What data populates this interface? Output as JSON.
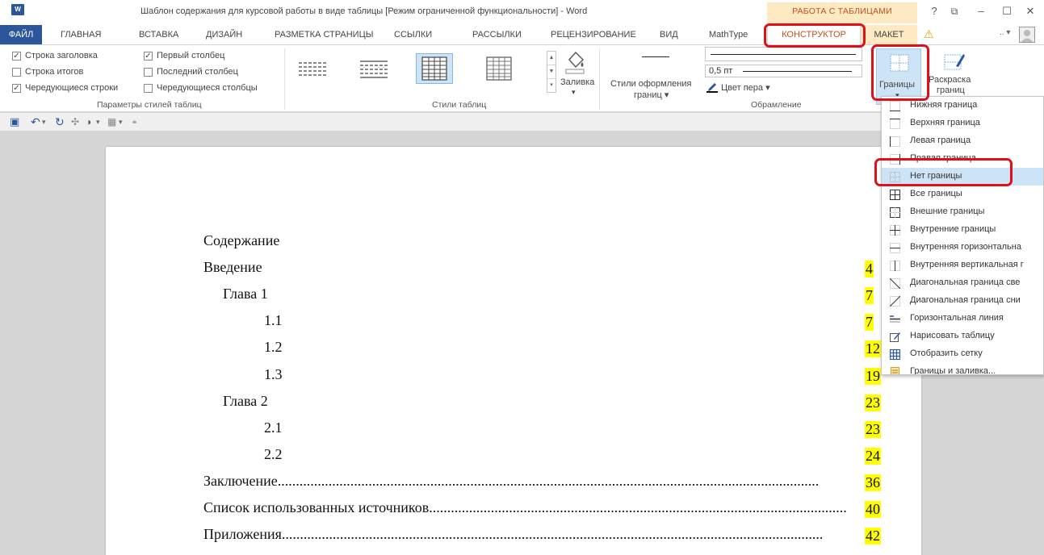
{
  "app": {
    "icon_label": "W",
    "title": "Шаблон содержания для курсовой работы в виде таблицы [Режим ограниченной функциональности] - Word",
    "context_group": "РАБОТА С ТАБЛИЦАМИ",
    "window_controls": [
      "?",
      "⧉",
      "–",
      "☐",
      "✕"
    ]
  },
  "tabs": {
    "file": "ФАЙЛ",
    "items": [
      "ГЛАВНАЯ",
      "ВСТАВКА",
      "ДИЗАЙН",
      "РАЗМЕТКА СТРАНИЦЫ",
      "ССЫЛКИ",
      "РАССЫЛКИ",
      "РЕЦЕНЗИРОВАНИЕ",
      "ВИД",
      "MathType"
    ],
    "context_active": "КОНСТРУКТОР",
    "context_other": "МАКЕТ"
  },
  "ribbon": {
    "style_options": {
      "group_label": "Параметры стилей таблиц",
      "options": [
        {
          "label": "Строка заголовка",
          "checked": true
        },
        {
          "label": "Строка итогов",
          "checked": false
        },
        {
          "label": "Чередующиеся строки",
          "checked": true
        },
        {
          "label": "Первый столбец",
          "checked": true
        },
        {
          "label": "Последний столбец",
          "checked": false
        },
        {
          "label": "Чередующиеся столбцы",
          "checked": false
        }
      ]
    },
    "table_styles": {
      "group_label": "Стили таблиц",
      "shading_label": "Заливка"
    },
    "borders": {
      "group_label": "Обрамление",
      "border_styles_label": "Стили оформления",
      "border_styles_label2": "границ ▾",
      "line_weight": "0,5 пт",
      "pen_color_label": "Цвет пера ▾",
      "borders_label": "Границы",
      "painter_label": "Раскраска",
      "painter_label2": "границ"
    }
  },
  "document": {
    "lines": [
      {
        "text": "Содержание",
        "page": ""
      },
      {
        "text": "Введение",
        "page": "4"
      },
      {
        "text": "Глава 1",
        "page": "7"
      },
      {
        "text": "1.1",
        "page": "7"
      },
      {
        "text": "1.2",
        "page": "12"
      },
      {
        "text": "1.3",
        "page": "19"
      },
      {
        "text": "Глава 2",
        "page": "23"
      },
      {
        "text": "2.1",
        "page": "23"
      },
      {
        "text": "2.2",
        "page": "24"
      },
      {
        "text": "Заключение",
        "page": "36"
      },
      {
        "text": "Список использованных источников",
        "page": "40"
      },
      {
        "text": "Приложения",
        "page": "42"
      }
    ]
  },
  "dropdown": {
    "items": [
      "Нижняя граница",
      "Верхняя граница",
      "Левая граница",
      "Правая граница",
      "Нет границы",
      "Все границы",
      "Внешние границы",
      "Внутренние границы",
      "Внутренняя горизонтальна",
      "Внутренняя вертикальная г",
      "Диагональная граница све",
      "Диагональная граница сни",
      "Горизонтальная линия",
      "Нарисовать таблицу",
      "Отобразить сетку",
      "Границы и заливка..."
    ],
    "highlighted_index": 4
  },
  "colors": {
    "word_blue": "#2b579a",
    "context_orange": "#c6501a",
    "context_fill": "#fde9c2",
    "annotation_red": "#e0101a",
    "highlight_yellow": "#ffff00"
  }
}
